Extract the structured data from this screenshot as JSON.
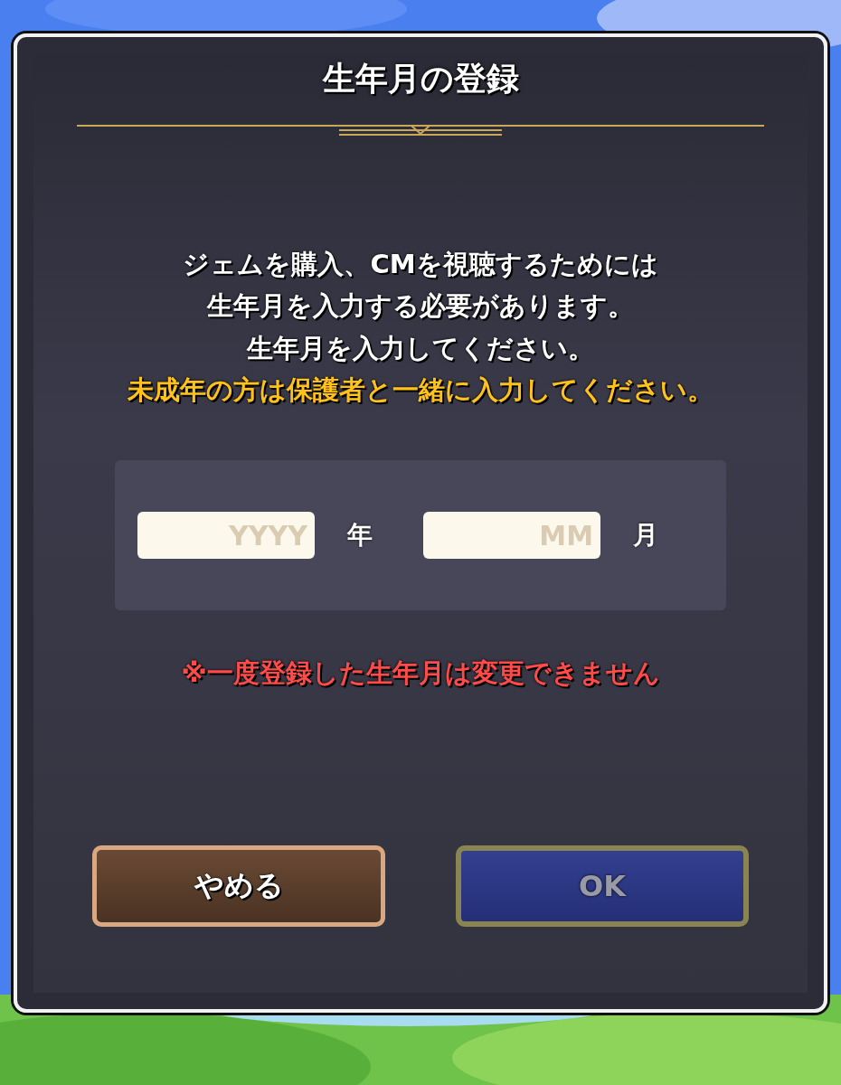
{
  "dialog": {
    "title": "生年月の登録",
    "message_lines": [
      {
        "text": "ジェムを購入、CMを視聴するためには",
        "kind": "normal"
      },
      {
        "text": "生年月を入力する必要があります。",
        "kind": "normal"
      },
      {
        "text": "生年月を入力してください。",
        "kind": "normal"
      },
      {
        "text": "未成年の方は保護者と一緒に入力してください。",
        "kind": "warning"
      }
    ],
    "fields": [
      {
        "placeholder": "YYYY",
        "unit": "年"
      },
      {
        "placeholder": "MM",
        "unit": "月"
      }
    ],
    "note": "※一度登録した生年月は変更できません",
    "buttons": [
      {
        "label": "やめる",
        "kind": "cancel",
        "disabled": false
      },
      {
        "label": "OK",
        "kind": "confirm",
        "disabled": true
      }
    ]
  }
}
